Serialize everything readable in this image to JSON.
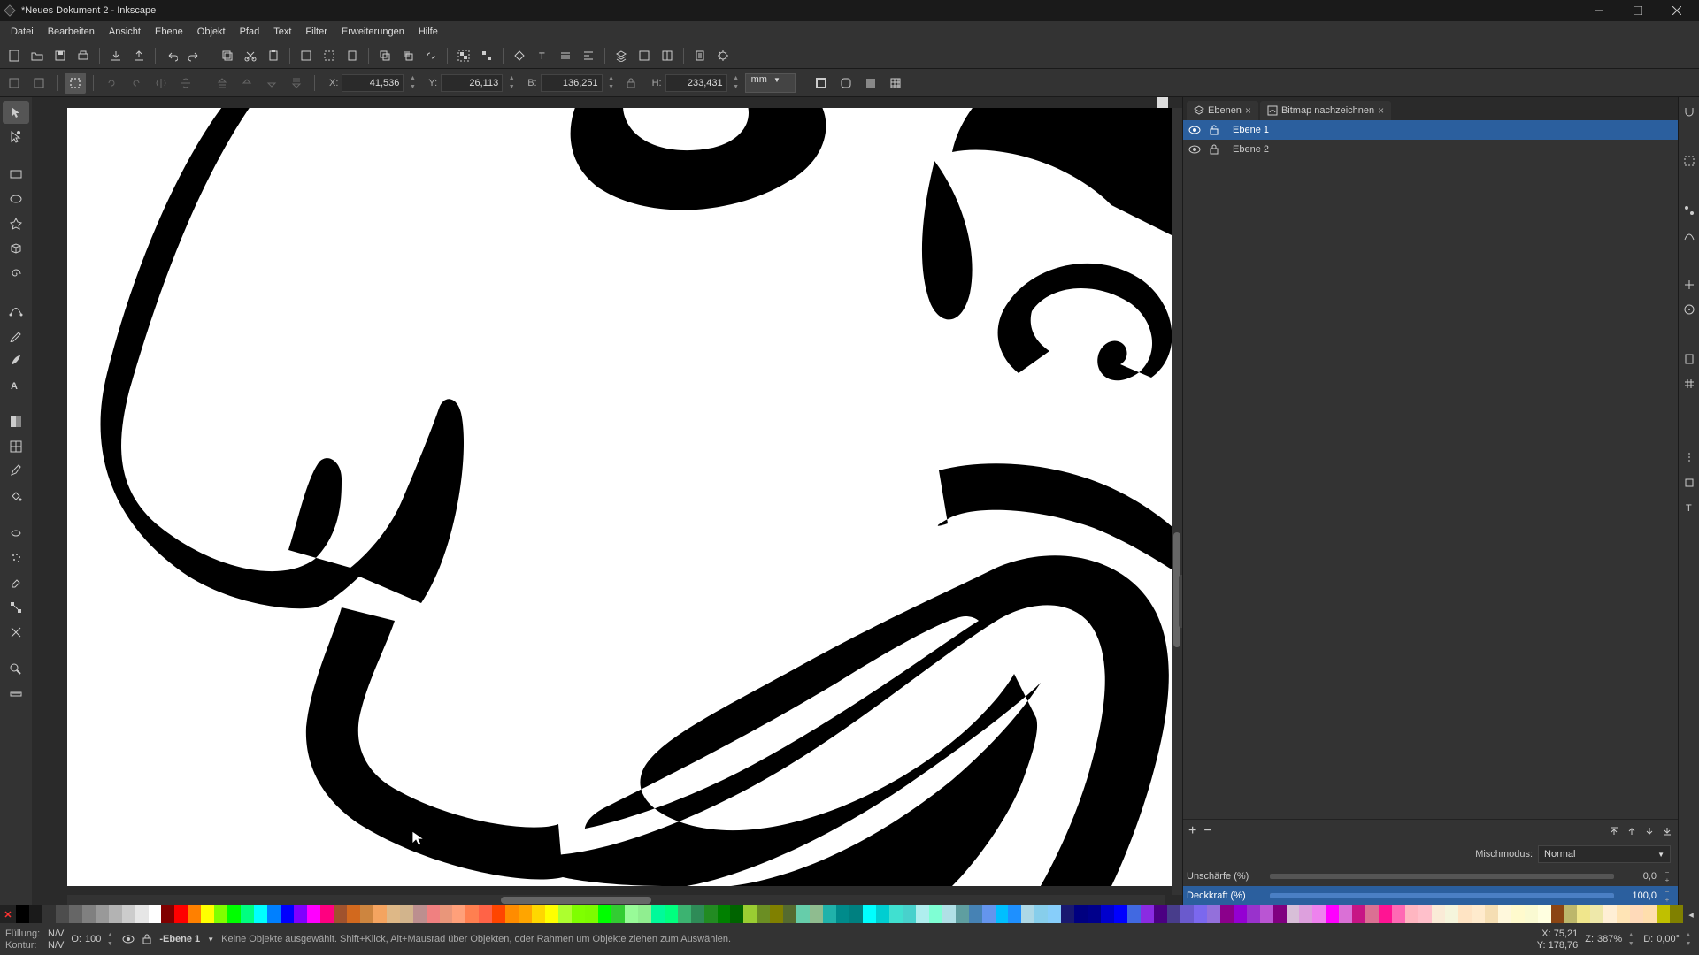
{
  "title": "*Neues Dokument 2 - Inkscape",
  "menus": [
    "Datei",
    "Bearbeiten",
    "Ansicht",
    "Ebene",
    "Objekt",
    "Pfad",
    "Text",
    "Filter",
    "Erweiterungen",
    "Hilfe"
  ],
  "coords": {
    "x_label": "X:",
    "x": "41,536",
    "y_label": "Y:",
    "y": "26,113",
    "w_label": "B:",
    "w": "136,251",
    "h_label": "H:",
    "h": "233,431",
    "unit": "mm"
  },
  "panels": {
    "layers_tab": "Ebenen",
    "trace_tab": "Bitmap nachzeichnen",
    "layers": [
      {
        "name": "Ebene 1",
        "visible": true,
        "locked": false,
        "selected": true
      },
      {
        "name": "Ebene 2",
        "visible": true,
        "locked": true,
        "selected": false
      }
    ],
    "blend_label": "Mischmodus:",
    "blend_mode": "Normal",
    "blur_label": "Unschärfe (%)",
    "blur_value": "0,0",
    "opacity_label": "Deckkraft (%)",
    "opacity_value": "100,0"
  },
  "status": {
    "fill_label": "Füllung:",
    "fill_value": "N/V",
    "stroke_label": "Kontur:",
    "stroke_value": "N/V",
    "opacity_prefix": "O:",
    "opacity": "100",
    "layer_indicator": "-Ebene 1",
    "hint": "Keine Objekte ausgewählt. Shift+Klick, Alt+Mausrad über Objekten, oder Rahmen um Objekte ziehen zum Auswählen.",
    "x_label": "X:",
    "x": "75,21",
    "y_label": "Y:",
    "y": "178,76",
    "z_label": "Z:",
    "z": "387%",
    "d_label": "D:",
    "d": "0,00°"
  },
  "palette": [
    "#000",
    "#1a1a1a",
    "#333",
    "#4d4d4d",
    "#666",
    "#808080",
    "#999",
    "#b3b3b3",
    "#ccc",
    "#e6e6e6",
    "#fff",
    "#800000",
    "#f00",
    "#ff8000",
    "#ff0",
    "#80ff00",
    "#0f0",
    "#00ff80",
    "#0ff",
    "#0080ff",
    "#00f",
    "#8000ff",
    "#f0f",
    "#ff0080",
    "#a0522d",
    "#d2691e",
    "#cd853f",
    "#f4a460",
    "#deb887",
    "#d2b48c",
    "#bc8f8f",
    "#f08080",
    "#e9967a",
    "#ffa07a",
    "#ff7f50",
    "#ff6347",
    "#ff4500",
    "#ff8c00",
    "#ffa500",
    "#ffd700",
    "#ffff00",
    "#adff2f",
    "#7fff00",
    "#7cfc00",
    "#00ff00",
    "#32cd32",
    "#98fb98",
    "#90ee90",
    "#00fa9a",
    "#00ff7f",
    "#3cb371",
    "#2e8b57",
    "#228b22",
    "#008000",
    "#006400",
    "#9acd32",
    "#6b8e23",
    "#808000",
    "#556b2f",
    "#66cdaa",
    "#8fbc8f",
    "#20b2aa",
    "#008b8b",
    "#008080",
    "#00ffff",
    "#00ced1",
    "#40e0d0",
    "#48d1cc",
    "#afeeee",
    "#7fffd4",
    "#b0e0e6",
    "#5f9ea0",
    "#4682b4",
    "#6495ed",
    "#00bfff",
    "#1e90ff",
    "#add8e6",
    "#87ceeb",
    "#87cefa",
    "#191970",
    "#000080",
    "#00008b",
    "#0000cd",
    "#0000ff",
    "#4169e1",
    "#8a2be2",
    "#4b0082",
    "#483d8b",
    "#6a5acd",
    "#7b68ee",
    "#9370db",
    "#8b008b",
    "#9400d3",
    "#9932cc",
    "#ba55d3",
    "#800080",
    "#d8bfd8",
    "#dda0dd",
    "#ee82ee",
    "#ff00ff",
    "#da70d6",
    "#c71585",
    "#db7093",
    "#ff1493",
    "#ff69b4",
    "#ffb6c1",
    "#ffc0cb",
    "#faebd7",
    "#f5f5dc",
    "#ffe4c4",
    "#ffebcd",
    "#f5deb3",
    "#fff8dc",
    "#fffacd",
    "#fafad2",
    "#ffffe0",
    "#8b4513",
    "#bdb76b",
    "#f0e68c",
    "#eee8aa",
    "#ffefd5",
    "#ffe4b5",
    "#ffdab9",
    "#ffdead",
    "#c0c000",
    "#808000"
  ]
}
